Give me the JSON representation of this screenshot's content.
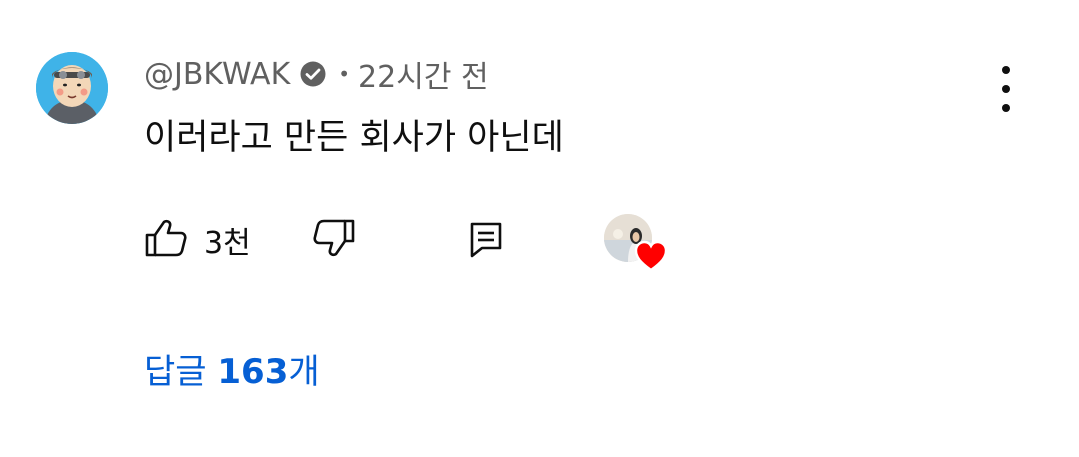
{
  "comment": {
    "author": "@JBKWAK",
    "verified_icon": "verified-check-icon",
    "separator": "•",
    "time": "22시간 전",
    "text": "이러라고 만든 회사가 아닌데",
    "likes": "3천",
    "replies_prefix": "답글 ",
    "replies_count": "163",
    "replies_suffix": "개"
  },
  "icons": {
    "like": "thumbs-up-icon",
    "dislike": "thumbs-down-icon",
    "reply": "reply-comment-icon",
    "menu": "more-vertical-icon",
    "heart": "creator-heart-icon"
  },
  "colors": {
    "text": "#0f0f0f",
    "secondary": "#606060",
    "link": "#065fd4",
    "heart": "#ff0000",
    "avatar_bg": "#3fb3e8"
  }
}
